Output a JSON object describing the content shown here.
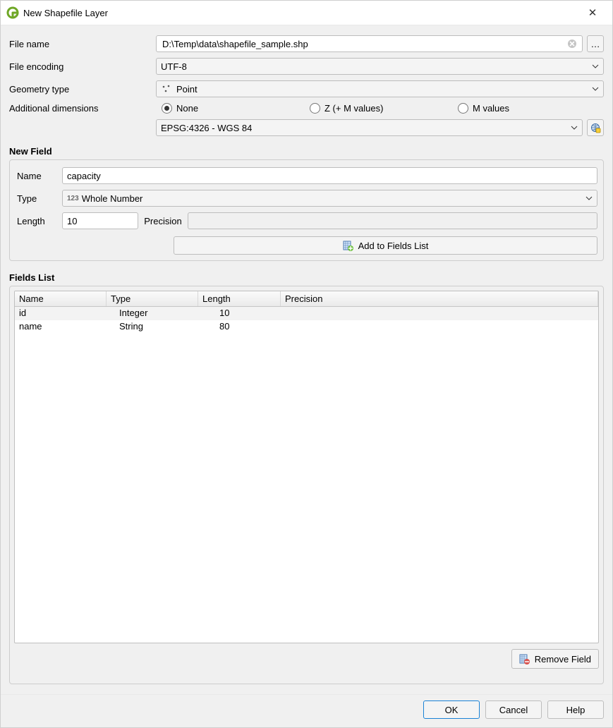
{
  "window": {
    "title": "New Shapefile Layer"
  },
  "labels": {
    "file_name": "File name",
    "file_encoding": "File encoding",
    "geometry_type": "Geometry type",
    "additional_dimensions": "Additional dimensions",
    "new_field": "New Field",
    "name": "Name",
    "type": "Type",
    "length": "Length",
    "precision": "Precision",
    "add_to_fields_list": "Add to Fields List",
    "fields_list": "Fields List",
    "remove_field": "Remove Field",
    "ok": "OK",
    "cancel": "Cancel",
    "help": "Help",
    "browse": "…"
  },
  "fields_list_headers": {
    "name": "Name",
    "type": "Type",
    "length": "Length",
    "precision": "Precision"
  },
  "values": {
    "file_name": "D:\\Temp\\data\\shapefile_sample.shp",
    "file_encoding": "UTF-8",
    "geometry_type": "Point",
    "field_type": "Whole Number",
    "field_type_prefix": "123",
    "crs": "EPSG:4326 - WGS 84",
    "new_field_name": "capacity",
    "new_field_length": "10",
    "new_field_precision": ""
  },
  "radios": {
    "none": "None",
    "z": "Z (+ M values)",
    "m": "M values",
    "selected": "none"
  },
  "fields_list": [
    {
      "name": "id",
      "type": "Integer",
      "length": "10",
      "precision": ""
    },
    {
      "name": "name",
      "type": "String",
      "length": "80",
      "precision": ""
    }
  ]
}
